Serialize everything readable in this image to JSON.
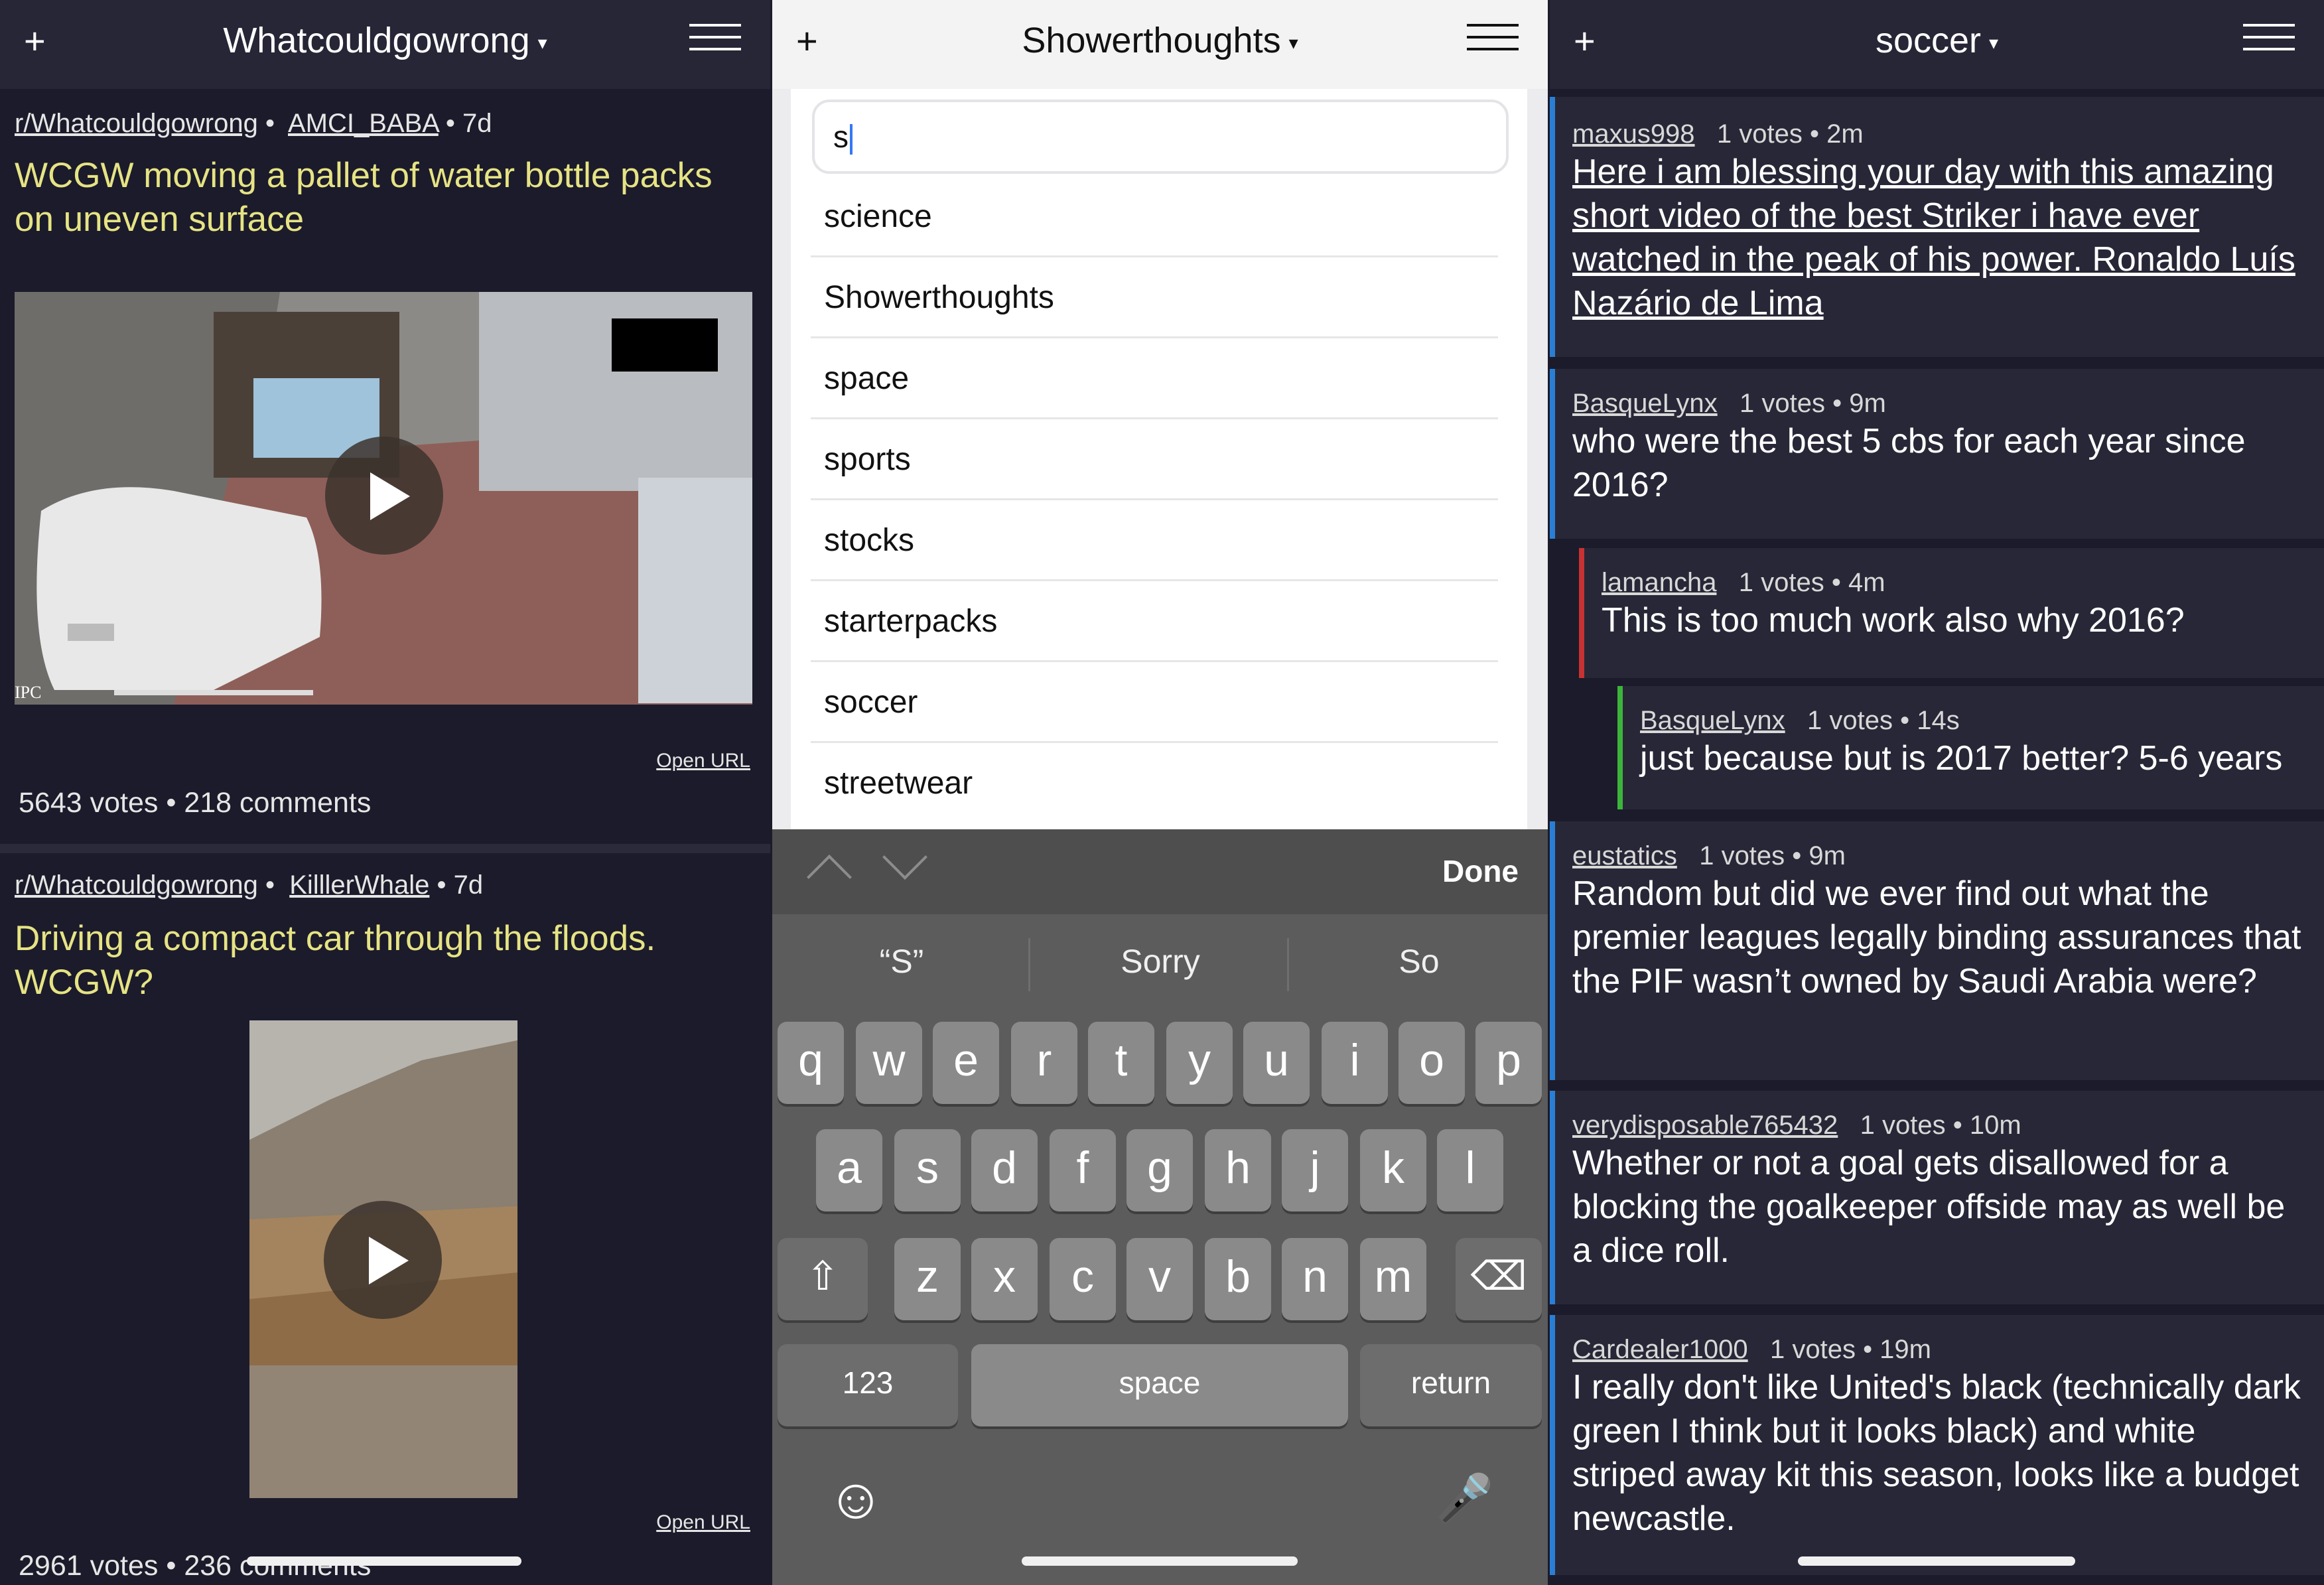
{
  "left_panel": {
    "header": {
      "plus": "+",
      "title": "Whatcouldgowrong",
      "caret": "▾"
    },
    "posts": [
      {
        "subreddit": "r/Whatcouldgowrong",
        "author": "AMCI_BABA",
        "age": "• 7d",
        "title": "WCGW moving a pallet of water bottle packs on uneven surface",
        "media_caption": "IPC",
        "open_url": "Open URL",
        "stats": "5643 votes • 218 comments"
      },
      {
        "subreddit": "r/Whatcouldgowrong",
        "author": "KilllerWhale",
        "age": "• 7d",
        "title": "Driving a compact car through the floods. WCGW?",
        "open_url": "Open URL",
        "stats": "2961 votes • 236 comments"
      }
    ]
  },
  "middle_panel": {
    "header": {
      "plus": "+",
      "title": "Showerthoughts",
      "caret": "▾"
    },
    "search": {
      "value": "s"
    },
    "suggestions": [
      "science",
      "Showerthoughts",
      "space",
      "sports",
      "stocks",
      "starterpacks",
      "soccer",
      "streetwear"
    ],
    "keyboard": {
      "done": "Done",
      "predictions": [
        "“S”",
        "Sorry",
        "So"
      ],
      "row1": [
        "q",
        "w",
        "e",
        "r",
        "t",
        "y",
        "u",
        "i",
        "o",
        "p"
      ],
      "row2": [
        "a",
        "s",
        "d",
        "f",
        "g",
        "h",
        "j",
        "k",
        "l"
      ],
      "row3": [
        "z",
        "x",
        "c",
        "v",
        "b",
        "n",
        "m"
      ],
      "numbers": "123",
      "space": "space",
      "return": "return",
      "shift_icon": "⇧",
      "delete_icon": "⌫",
      "emoji_icon": "☺",
      "mic_icon": "🎤"
    }
  },
  "right_panel": {
    "header": {
      "plus": "+",
      "title": "soccer",
      "caret": "▾"
    },
    "comments": [
      {
        "user": "maxus998",
        "meta": "1 votes • 2m",
        "text": "Here i am blessing your day with this amazing short video of the best Striker i have ever watched in the peak of his power. Ronaldo Luís Nazário de Lima",
        "bar_color": "#2a7fd4"
      },
      {
        "user": "BasqueLynx",
        "meta": "1 votes • 9m",
        "text": "who were the best 5 cbs for each year since 2016?",
        "bar_color": "#2a7fd4"
      },
      {
        "user": "lamancha",
        "meta": "1 votes • 4m",
        "text": "This is too much work also why 2016?",
        "bar_color": "#c83232"
      },
      {
        "user": "BasqueLynx",
        "meta": "1 votes • 14s",
        "text": "just because but is 2017 better? 5-6 years",
        "bar_color": "#3cb43c"
      },
      {
        "user": "eustatics",
        "meta": "1 votes • 9m",
        "text": "Random but did we ever find out what the premier leagues legally binding assurances that the PIF wasn’t owned by Saudi Arabia were?",
        "bar_color": "#2a7fd4"
      },
      {
        "user": "verydisposable765432",
        "meta": "1 votes • 10m",
        "text": "Whether or not a goal gets disallowed for a blocking the goalkeeper offside may as well be a dice roll.",
        "bar_color": "#2a7fd4"
      },
      {
        "user": "Cardealer1000",
        "meta": "1 votes • 19m",
        "text": "I really don't like United's black (technically dark green I think but it looks black) and white striped away kit this season, looks like a budget newcastle.",
        "bar_color": "#2a7fd4"
      }
    ]
  }
}
